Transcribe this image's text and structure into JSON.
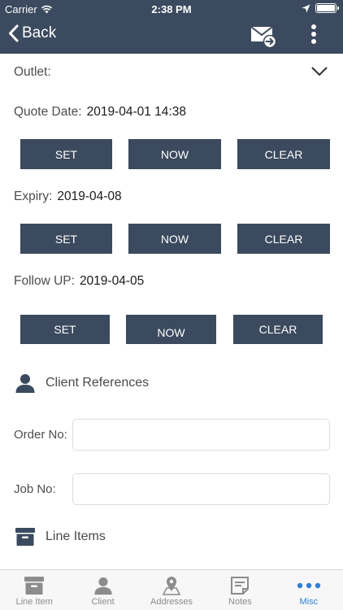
{
  "status_bar": {
    "carrier": "Carrier",
    "time": "2:38 PM"
  },
  "nav": {
    "back_label": "Back"
  },
  "form": {
    "outlet_label": "Outlet:",
    "quote_date": {
      "label": "Quote Date:",
      "value": "2019-04-01 14:38"
    },
    "expiry": {
      "label": "Expiry:",
      "value": "2019-04-08"
    },
    "follow_up": {
      "label": "Follow UP:",
      "value": "2019-04-05"
    },
    "buttons": {
      "set": "SET",
      "now": "NOW",
      "clear": "CLEAR"
    }
  },
  "client_references": {
    "title": "Client References",
    "order_no": {
      "label": "Order No:",
      "value": ""
    },
    "job_no": {
      "label": "Job No:",
      "value": ""
    }
  },
  "line_items": {
    "title": "Line Items"
  },
  "tabbar": {
    "active": "Misc",
    "tabs": [
      {
        "label": "Line Item",
        "icon": "archive-box-icon"
      },
      {
        "label": "Client",
        "icon": "person-icon"
      },
      {
        "label": "Addresses",
        "icon": "map-pin-icon"
      },
      {
        "label": "Notes",
        "icon": "note-icon"
      },
      {
        "label": "Misc",
        "icon": "more-dots-icon"
      }
    ]
  },
  "colors": {
    "header": "#3b4a5e",
    "button": "#3b4a5e",
    "active_tab": "#2f7fd6"
  }
}
